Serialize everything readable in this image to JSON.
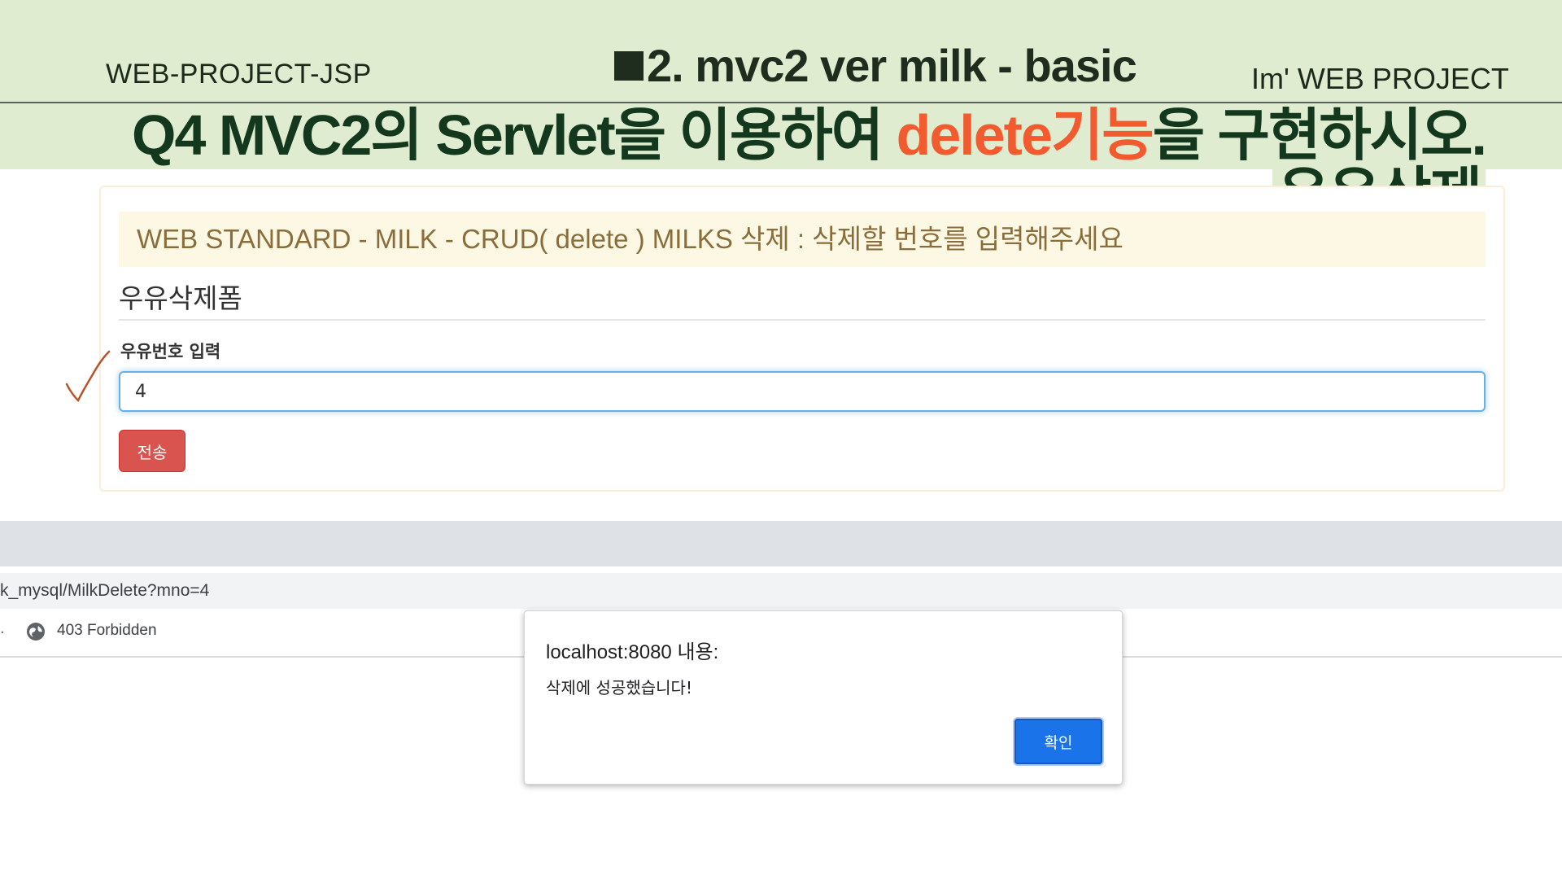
{
  "slide": {
    "left_title": "WEB-PROJECT-JSP",
    "center_title": "2. mvc2 ver  milk - basic",
    "right_title": "Im'  WEB PROJECT",
    "question_prefix": "Q4  MVC2의 Servlet을 이용하여 ",
    "question_highlight": "delete기능",
    "question_suffix": "을 구현하시오.",
    "question_sub": "우유삭제",
    "highlight_color": "#f25a30",
    "band_color": "#dfeccf"
  },
  "form_panel": {
    "heading": "WEB STANDARD - MILK - CRUD( delete ) MILKS 삭제 : 삭제할 번호를 입력해주세요",
    "form_title": "우유삭제폼",
    "field_label": "우유번호 입력",
    "field_value": "4",
    "submit_label": "전송",
    "submit_color": "#d9534f"
  },
  "browser": {
    "address": "k_mysql/MilkDelete?mno=4",
    "tab_prefix": ".",
    "tab_icon": "globe-icon",
    "tab_title": "403 Forbidden"
  },
  "dialog": {
    "title": "localhost:8080 내용:",
    "message": "삭제에 성공했습니다!",
    "ok_label": "확인",
    "ok_color": "#1a73e8"
  }
}
